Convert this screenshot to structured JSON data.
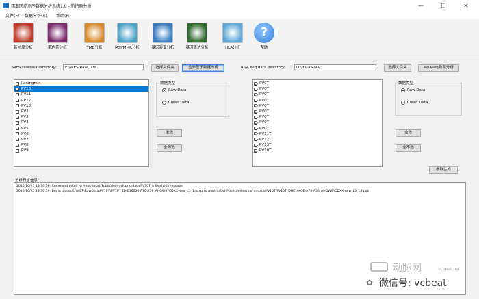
{
  "window": {
    "title": "精准医疗测序数据分析系统1.0 - 新抗原分析",
    "minimize": "—",
    "maximize": "☐",
    "close": "✕"
  },
  "menu": [
    "文件(F)",
    "数据分析(A)",
    "帮助(H)"
  ],
  "toolbar": [
    {
      "label": "新抗原分析",
      "icon": "neoantigen-icon",
      "color": "#c0392b"
    },
    {
      "label": "肥内药分析",
      "icon": "drug-icon",
      "color": "#7b2d6e"
    },
    {
      "label": "TMB分析",
      "icon": "tmb-icon",
      "color": "#d98b2b"
    },
    {
      "label": "MSI/MMR分析",
      "icon": "msi-icon",
      "color": "#4aa3c7"
    },
    {
      "label": "基因突变分析",
      "icon": "dna-icon",
      "color": "#3a7bbf"
    },
    {
      "label": "基因表达分析",
      "icon": "expression-icon",
      "color": "#2f6b2f"
    },
    {
      "label": "HLA分析",
      "icon": "hla-icon",
      "color": "#5fa8d8"
    },
    {
      "label": "帮助",
      "icon": "help-icon",
      "color": "#3b82d6"
    }
  ],
  "wes": {
    "dir_label": "WES rawdata directory:",
    "dir_value": "E:\\WES\\RawData",
    "browse_button": "选择文件夹",
    "submit_button": "全外显子数据分析",
    "items": [
      {
        "name": "lianingmin",
        "checked": false,
        "selected": false
      },
      {
        "name": "PV10",
        "checked": true,
        "selected": true
      },
      {
        "name": "PV11",
        "checked": false,
        "selected": false
      },
      {
        "name": "PV12",
        "checked": false,
        "selected": false
      },
      {
        "name": "PV13",
        "checked": false,
        "selected": false
      },
      {
        "name": "PV2",
        "checked": false,
        "selected": false
      },
      {
        "name": "PV3",
        "checked": false,
        "selected": false
      },
      {
        "name": "PV4",
        "checked": false,
        "selected": false
      },
      {
        "name": "PV5",
        "checked": false,
        "selected": false
      },
      {
        "name": "PV6",
        "checked": false,
        "selected": false
      },
      {
        "name": "PV7",
        "checked": false,
        "selected": false
      },
      {
        "name": "PV8",
        "checked": false,
        "selected": false
      },
      {
        "name": "PV9",
        "checked": false,
        "selected": false
      }
    ],
    "data_type_title": "数据类型",
    "raw_data": "Raw Data",
    "clean_data": "Clean Data",
    "select_all": "全选",
    "deselect_all": "全不选"
  },
  "rna": {
    "dir_label": "RNA seq data directory:",
    "dir_value": "D:\\data\\RNA",
    "browse_button": "选择文件夹",
    "submit_button": "RNAseq数据分析",
    "items": [
      {
        "name": "PV0T",
        "checked": true
      },
      {
        "name": "PV0T",
        "checked": true
      },
      {
        "name": "PV0T",
        "checked": true
      },
      {
        "name": "PV0T",
        "checked": true
      },
      {
        "name": "PV0T",
        "checked": true
      },
      {
        "name": "PV0T",
        "checked": true
      },
      {
        "name": "PV0T",
        "checked": true
      },
      {
        "name": "PV0T",
        "checked": true
      },
      {
        "name": "PV0T",
        "checked": true
      },
      {
        "name": "PV11T",
        "checked": true
      },
      {
        "name": "PV12T",
        "checked": true
      },
      {
        "name": "PV13T",
        "checked": true
      },
      {
        "name": "PV10T",
        "checked": true
      }
    ],
    "data_type_title": "数据类型",
    "raw_data": "Raw Data",
    "clean_data": "Clean Data",
    "select_all": "全选",
    "deselect_all": "全不选"
  },
  "params_button": "参数生成",
  "log": {
    "label": "分析日志信息：",
    "lines": [
      "2016/10/23 13:36:59: Command mkdir -p /mnt/data2/Public/lei/nosha/randata/PV10T is finished,message",
      "2016/10/23 13:36:59: Begin uploadE:\\WES\\RawData\\PV10T\\PV10T_DHE16036-A70-A36_AHGW9YCDXX-new_L3_1.fq.gz to /mnt/data2/Public/lei/nosha/randata/PV10T/PV10T_DHE16036-A70-A36_AHGW9YCDXX-new_L3_1.fq.gz"
    ]
  },
  "watermark": {
    "site": "动脉网",
    "domain": "vcbeat.net",
    "wechat": "微信号: vcbeat"
  }
}
